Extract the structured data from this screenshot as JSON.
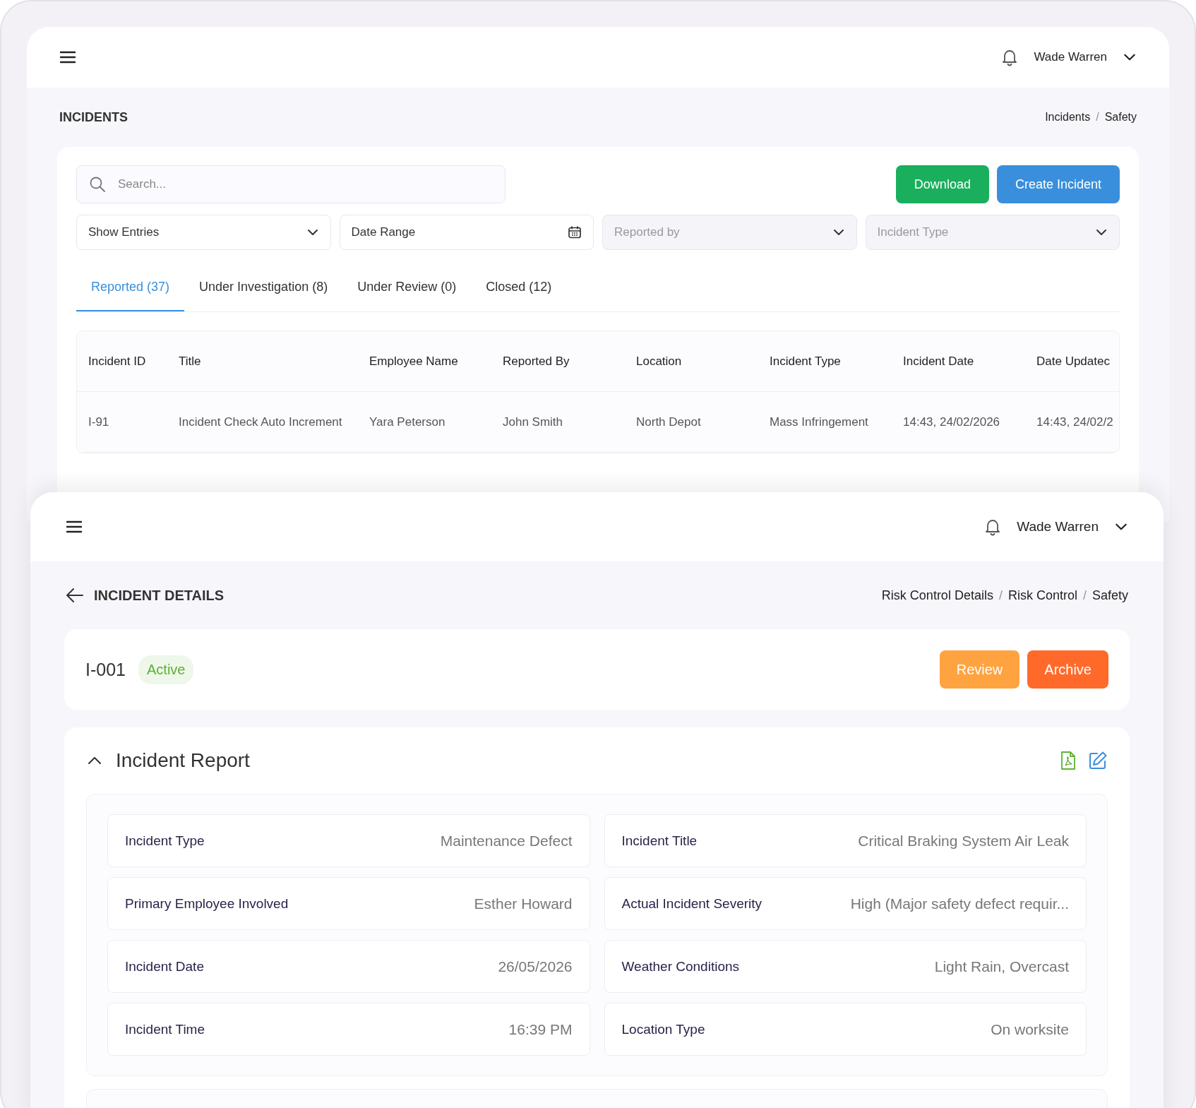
{
  "list_screen": {
    "header": {
      "user": "Wade Warren"
    },
    "title": "INCIDENTS",
    "breadcrumb": [
      "Incidents",
      "Safety"
    ],
    "breadcrumb_separator": "/",
    "search": {
      "placeholder": "Search..."
    },
    "buttons": [
      {
        "label": "Download",
        "color": "#1aaf5d"
      },
      {
        "label": "Create Incident",
        "color": "#3a8fdc"
      }
    ],
    "filters": [
      {
        "label": "Show Entries",
        "kind": "select",
        "disabled": false
      },
      {
        "label": "Date Range",
        "kind": "date",
        "disabled": false
      },
      {
        "label": "Reported by",
        "kind": "select",
        "disabled": true
      },
      {
        "label": "Incident Type",
        "kind": "select",
        "disabled": true
      }
    ],
    "tabs": [
      {
        "label": "Reported (37)",
        "selected": true
      },
      {
        "label": "Under Investigation (8)",
        "selected": false
      },
      {
        "label": "Under Review (0)",
        "selected": false
      },
      {
        "label": "Closed (12)",
        "selected": false
      }
    ],
    "table": {
      "columns": [
        "Incident ID",
        "Title",
        "Employee Name",
        "Reported By",
        "Location",
        "Incident Type",
        "Incident Date",
        "Date Updatec"
      ],
      "rows": [
        [
          "I-91",
          "Incident Check Auto Increment",
          "Yara Peterson",
          "John Smith",
          "North Depot",
          "Mass Infringement",
          "14:43, 24/02/2026",
          "14:43, 24/02/2"
        ]
      ]
    }
  },
  "detail_screen": {
    "header": {
      "user": "Wade Warren"
    },
    "title": "INCIDENT DETAILS",
    "breadcrumb": [
      "Risk Control Details",
      "Risk Control",
      "Safety"
    ],
    "breadcrumb_separator": "/",
    "record": {
      "id": "I-001",
      "status": "Active"
    },
    "buttons": [
      {
        "label": "Review",
        "color": "#ffa340"
      },
      {
        "label": "Archive",
        "color": "#ff6a2b"
      }
    ],
    "report": {
      "title": "Incident Report",
      "expanded": true,
      "fields": [
        {
          "label": "Incident Type",
          "value": "Maintenance Defect"
        },
        {
          "label": "Incident Title",
          "value": "Critical Braking System Air Leak"
        },
        {
          "label": "Primary Employee Involved",
          "value": "Esther Howard"
        },
        {
          "label": "Actual Incident Severity",
          "value": "High (Major safety defect requir..."
        },
        {
          "label": "Incident Date",
          "value": "26/05/2026"
        },
        {
          "label": "Weather Conditions",
          "value": "Light Rain, Overcast"
        },
        {
          "label": "Incident Time",
          "value": "16:39 PM"
        },
        {
          "label": "Location Type",
          "value": "On worksite"
        }
      ]
    }
  }
}
